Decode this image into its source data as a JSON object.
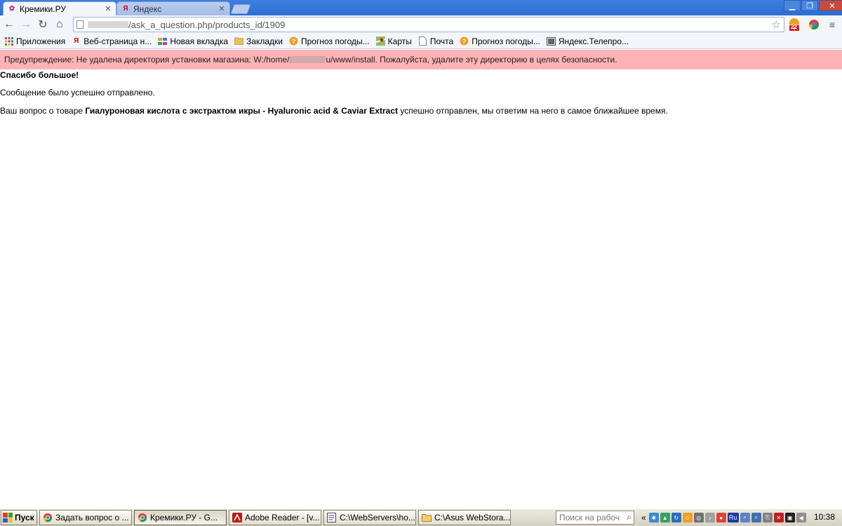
{
  "browser": {
    "tabs": [
      {
        "label": "Кремики.РУ",
        "active": true
      },
      {
        "label": "Яндекс",
        "active": false
      }
    ],
    "address": {
      "url_visible": "/ask_a_question.php/products_id/1909"
    },
    "extension_badge": "22",
    "bookmarks": [
      {
        "label": "Приложения",
        "icon": "apps-grid-icon"
      },
      {
        "label": "Веб-страница н...",
        "icon": "yandex-y-icon"
      },
      {
        "label": "Новая вкладка",
        "icon": "tiles-icon"
      },
      {
        "label": "Закладки",
        "icon": "folder-icon"
      },
      {
        "label": "Прогноз погоды...",
        "icon": "weather-icon"
      },
      {
        "label": "Карты",
        "icon": "maps-icon"
      },
      {
        "label": "Почта",
        "icon": "page-icon"
      },
      {
        "label": "Прогноз погоды...",
        "icon": "weather-icon"
      },
      {
        "label": "Яндекс.Телепро...",
        "icon": "tv-icon"
      }
    ]
  },
  "page": {
    "warning": {
      "before": "Предупреждение: Не удалена директория установки магазина: W:/home/",
      "after": "u/www/install. Пожалуйста, удалите эту директорию в целях безопасности."
    },
    "thanks": "Спасибо большое!",
    "message_sent": "Сообщение было успешно отправлено.",
    "question": {
      "prefix": "Ваш вопрос о товаре ",
      "product": "Гиалуроновая кислота с экстрактом икры - Hyaluronic acid & Caviar Extract",
      "suffix": " успешно отправлен, мы ответим на него в самое ближайшее время."
    }
  },
  "taskbar": {
    "start_label": "Пуск",
    "tasks": [
      {
        "label": "Задать вопрос о ...",
        "icon": "chrome-icon",
        "active": false
      },
      {
        "label": "Кремики.РУ - G...",
        "icon": "chrome-icon",
        "active": true
      },
      {
        "label": "Adobe Reader - [v...",
        "icon": "adobe-reader-icon",
        "active": false
      },
      {
        "label": "C:\\WebServers\\ho...",
        "icon": "notepad-icon",
        "active": false
      },
      {
        "label": "C:\\Asus WebStora...",
        "icon": "folder-icon",
        "active": false
      }
    ],
    "search_placeholder": "Поиск на рабоч",
    "language": "Ru",
    "clock": "10:38"
  },
  "colors": {
    "warning_bg": "#ffb3b5",
    "titlebar": "#3d7fe0"
  }
}
